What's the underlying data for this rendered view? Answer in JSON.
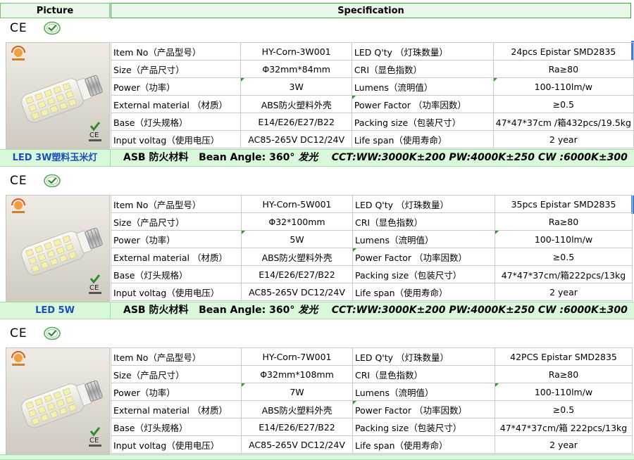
{
  "header": {
    "picture_label": "Picture",
    "specification_label": "Specification"
  },
  "colors": {
    "accent_green": "#3aa83a",
    "bar_bg": "#d9f7d9",
    "name_blue": "#1b4fc1"
  },
  "certifications": {
    "ce_mark": "CE",
    "check_icon": "check-circle-icon"
  },
  "products": [
    {
      "name": "LED 3W塑料玉米灯",
      "rows": [
        [
          "Item No（产品型号）",
          "HY-Corn-3W001",
          "LED Q'ty （灯珠数量）",
          "24pcs  Epistar SMD2835"
        ],
        [
          "Size（产品尺寸）",
          "Φ32mm*84mm",
          "CRI（显色指数）",
          "Ra≥80"
        ],
        [
          "Power（功率）",
          "3W",
          "Lumens（流明值）",
          "100-110lm/w"
        ],
        [
          "External material （材质）",
          "ABS防火塑料外壳",
          " Power Factor （功率因数）",
          "≥0.5"
        ],
        [
          "Base（灯头规格）",
          "E14/E26/E27/B22",
          "Packing size（包装尺寸）",
          "47*47*37cm /箱432pcs/19.5kg"
        ],
        [
          "Input voltag（使用电压）",
          "AC85-265V  DC12/24V",
          "Life span（使用寿命）",
          "2  year"
        ]
      ],
      "bar_material": "ASB 防火材料",
      "bar_angle": "Bean Angle:  360°",
      "bar_glow": "发光",
      "bar_cct": "CCT:WW:3000K±200   PW:4000K±250    CW :6000K±300"
    },
    {
      "name": "LED 5W",
      "rows": [
        [
          "Item No（产品型号）",
          "HY-Corn-5W001",
          "LED Q'ty （灯珠数量）",
          "35pcs  Epistar SMD2835"
        ],
        [
          "Size（产品尺寸）",
          "Φ32*100mm",
          "CRI（显色指数）",
          "Ra≥80"
        ],
        [
          "Power（功率）",
          "5W",
          "Lumens（流明值）",
          "100-110lm/w"
        ],
        [
          "External material （材质）",
          "ABS防火塑料外壳",
          " Power Factor （功率因数）",
          "≥0.5"
        ],
        [
          "Base（灯头规格）",
          "E14/E26/E27/B22",
          "Packing size（包装尺寸）",
          "47*47*37cm/箱222pcs/13kg"
        ],
        [
          "Input voltag（使用电压）",
          "AC85-265V  DC12/24V",
          "Life span（使用寿命）",
          "2  year"
        ]
      ],
      "bar_material": "ASB 防火材料",
      "bar_angle": "Bean Angle:  360°",
      "bar_glow": "发光",
      "bar_cct": "CCT:WW:3000K±200   PW:4000K±250    CW :6000K±300"
    },
    {
      "name": "",
      "rows": [
        [
          "Item No（产品型号）",
          "HY-Corn-7W001",
          "LED Q'ty （灯珠数量）",
          "42PCS  Epistar SMD2835"
        ],
        [
          "Size（产品尺寸）",
          "Φ32mm*108mm",
          "CRI（显色指数）",
          "Ra≥80"
        ],
        [
          "Power（功率）",
          "7W",
          "Lumens（流明值）",
          "100-110lm/w"
        ],
        [
          "External material （材质）",
          "ABS防火塑料外壳",
          " Power Factor （功率因数）",
          "≥0.5"
        ],
        [
          "Base（灯头规格）",
          "E14/E26/E27/B22",
          "Packing size（包装尺寸）",
          "47*47*37cm/箱 222pcs/13kg"
        ],
        [
          "Input voltag（使用电压）",
          "AC85-265V  DC12/24V",
          "Life span（使用寿命）",
          "2  year"
        ]
      ]
    }
  ]
}
